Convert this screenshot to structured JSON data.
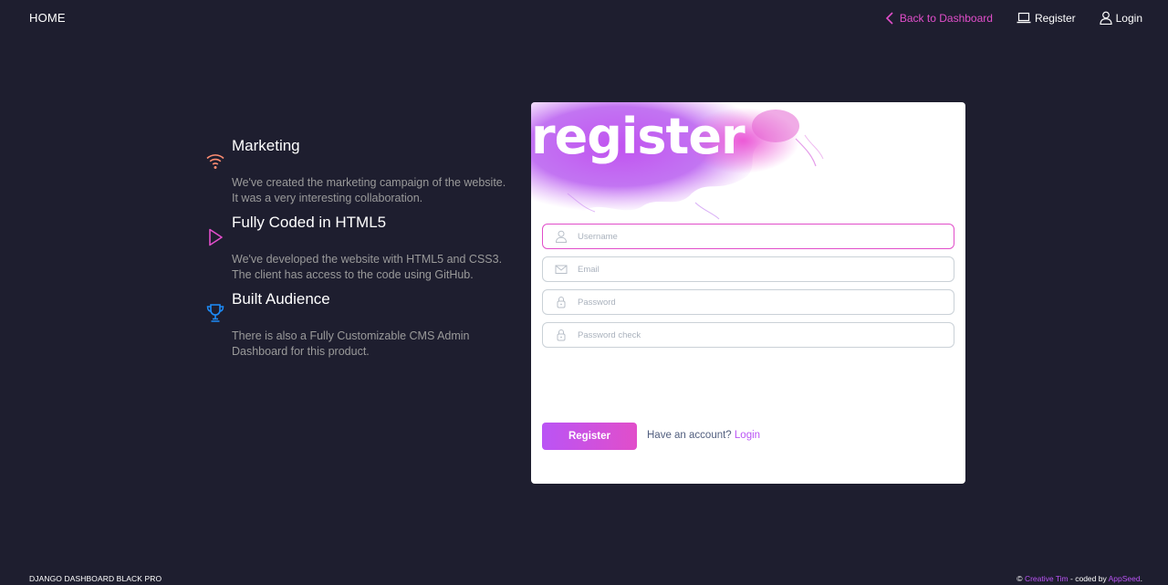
{
  "nav": {
    "brand": "HOME",
    "back_label": "Back to Dashboard",
    "register_label": "Register",
    "login_label": "Login"
  },
  "info": [
    {
      "icon": "wifi-icon",
      "title": "Marketing",
      "description": "We've created the marketing campaign of the website. It was a very interesting collaboration."
    },
    {
      "icon": "play-icon",
      "title": "Fully Coded in HTML5",
      "description": "We've developed the website with HTML5 and CSS3. The client has access to the code using GitHub."
    },
    {
      "icon": "trophy-icon",
      "title": "Built Audience",
      "description": "There is also a Fully Customizable CMS Admin Dashboard for this product."
    }
  ],
  "form": {
    "title": "register",
    "username_placeholder": "Username",
    "email_placeholder": "Email",
    "password_placeholder": "Password",
    "password_check_placeholder": "Password check",
    "submit_label": "Register",
    "have_account_text": "Have an account?",
    "login_link": "Login"
  },
  "footer": {
    "left": "DJANGO DASHBOARD BLACK PRO",
    "copyright": "©",
    "creative_tim": "Creative Tim",
    "coded_by": "- coded by",
    "appseed": "AppSeed",
    "dot": "."
  },
  "colors": {
    "background": "#1e1e2f",
    "primary": "#e14eca",
    "accent": "#ba54f5",
    "info": "#1d8cf8",
    "warning": "#ff8d72"
  }
}
